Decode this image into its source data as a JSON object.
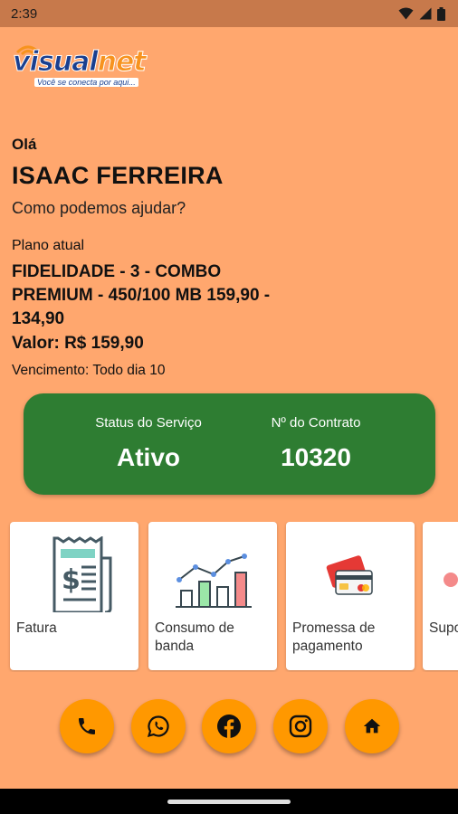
{
  "status_bar": {
    "time": "2:39",
    "icons": [
      "wifi-icon",
      "signal-icon",
      "battery-icon"
    ]
  },
  "logo": {
    "brand_part1": "visual",
    "brand_part2": "net",
    "tagline": "Você se conecta por aqui..."
  },
  "greeting": "Olá",
  "user_name": "ISAAC FERREIRA",
  "help_text": "Como podemos ajudar?",
  "plan": {
    "label": "Plano atual",
    "name": "FIDELIDADE - 3 - COMBO PREMIUM - 450/100 MB 159,90 - 134,90",
    "value": "Valor: R$ 159,90",
    "due": "Vencimento: Todo dia 10"
  },
  "service": {
    "status_label": "Status do Serviço",
    "status_value": "Ativo",
    "contract_label": "Nº do Contrato",
    "contract_value": "10320"
  },
  "menu": [
    {
      "label": "Fatura",
      "icon": "invoice-icon"
    },
    {
      "label": "Consumo de banda",
      "icon": "bandwidth-chart-icon"
    },
    {
      "label": "Promessa de pagamento",
      "icon": "credit-card-icon"
    },
    {
      "label": "Suporte",
      "icon": "support-icon"
    }
  ],
  "social": [
    {
      "icon": "phone-icon"
    },
    {
      "icon": "whatsapp-icon"
    },
    {
      "icon": "facebook-icon"
    },
    {
      "icon": "instagram-icon"
    },
    {
      "icon": "home-icon"
    }
  ],
  "colors": {
    "background": "#FFA76E",
    "status_bar": "#C7794B",
    "service_card": "#2E7D32",
    "social_button": "#FF9800"
  }
}
